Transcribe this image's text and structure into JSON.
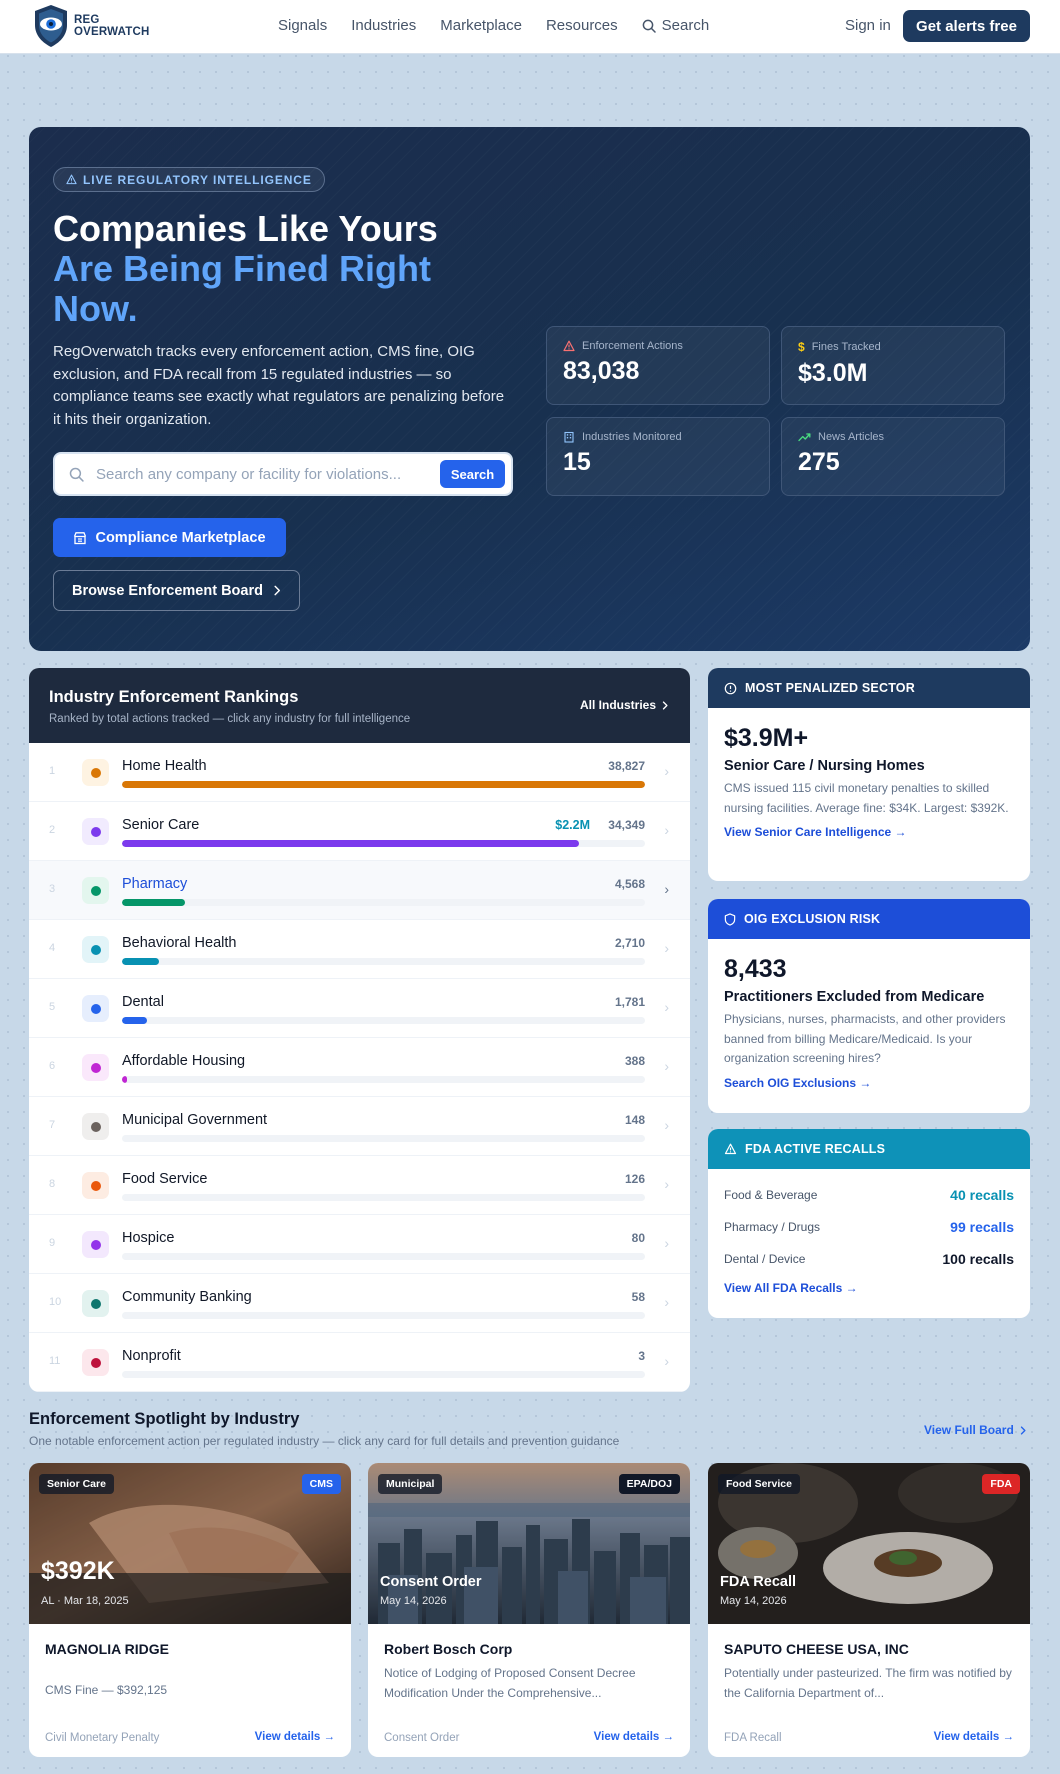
{
  "brand": {
    "line1": "REG",
    "line2": "OVERWATCH"
  },
  "nav": {
    "links": [
      "Signals",
      "Industries",
      "Marketplace",
      "Resources"
    ],
    "search_label": "Search",
    "signin": "Sign in",
    "cta": "Get alerts free"
  },
  "hero": {
    "pill": "LIVE REGULATORY INTELLIGENCE",
    "title_line1": "Companies Like Yours",
    "title_accent": "Are Being Fined Right Now.",
    "description": "RegOverwatch tracks every enforcement action, CMS fine, OIG exclusion, and FDA recall from 15 regulated industries — so compliance teams see exactly what regulators are penalizing before it hits their organization.",
    "search_placeholder": "Search any company or facility for violations...",
    "search_button": "Search",
    "btn_marketplace": "Compliance Marketplace",
    "btn_browse": "Browse Enforcement Board",
    "stats": [
      {
        "label": "Enforcement Actions",
        "value": "83,038"
      },
      {
        "label": "Fines Tracked",
        "value": "$3.0M"
      },
      {
        "label": "Industries Monitored",
        "value": "15"
      },
      {
        "label": "News Articles",
        "value": "275"
      }
    ]
  },
  "rankings": {
    "title": "Industry Enforcement Rankings",
    "subtitle": "Ranked by total actions tracked — click any industry for full intelligence",
    "all_label": "All Industries",
    "rows": [
      {
        "rank": "1",
        "name": "Home Health",
        "count": "38,827",
        "fine": "",
        "level": 1.0,
        "color": "#d97706",
        "bg": "#fef3e2"
      },
      {
        "rank": "2",
        "name": "Senior Care",
        "count": "34,349",
        "fine": "$2.2M",
        "level": 0.874,
        "color": "#7c3aed",
        "bg": "#f1ebfe"
      },
      {
        "rank": "3",
        "name": "Pharmacy",
        "count": "4,568",
        "fine": "",
        "level": 0.12,
        "color": "#059669",
        "bg": "#e3f6ee"
      },
      {
        "rank": "4",
        "name": "Behavioral Health",
        "count": "2,710",
        "fine": "",
        "level": 0.071,
        "color": "#0891b2",
        "bg": "#e2f4f8"
      },
      {
        "rank": "5",
        "name": "Dental",
        "count": "1,781",
        "fine": "",
        "level": 0.047,
        "color": "#2563eb",
        "bg": "#e6eefd"
      },
      {
        "rank": "6",
        "name": "Affordable Housing",
        "count": "388",
        "fine": "",
        "level": 0.008,
        "color": "#c026d3",
        "bg": "#fae8fb"
      },
      {
        "rank": "7",
        "name": "Municipal Government",
        "count": "148",
        "fine": "",
        "level": 0.0,
        "color": "#6b625e",
        "bg": "#efeeed"
      },
      {
        "rank": "8",
        "name": "Food Service",
        "count": "126",
        "fine": "",
        "level": 0.0,
        "color": "#ea580c",
        "bg": "#fdece2"
      },
      {
        "rank": "9",
        "name": "Hospice",
        "count": "80",
        "fine": "",
        "level": 0.0,
        "color": "#9333ea",
        "bg": "#f3e8fd"
      },
      {
        "rank": "10",
        "name": "Community Banking",
        "count": "58",
        "fine": "",
        "level": 0.0,
        "color": "#0f766e",
        "bg": "#e2f2ef"
      },
      {
        "rank": "11",
        "name": "Nonprofit",
        "count": "3",
        "fine": "",
        "level": 0.0,
        "color": "#be123c",
        "bg": "#fce7ec"
      }
    ]
  },
  "penalized": {
    "header": "MOST PENALIZED SECTOR",
    "value": "$3.9M+",
    "sector": "Senior Care / Nursing Homes",
    "description": "CMS issued 115 civil monetary penalties to skilled nursing facilities. Average fine: $34K. Largest: $392K.",
    "link": "View Senior Care Intelligence →"
  },
  "oig": {
    "header": "OIG EXCLUSION RISK",
    "value": "8,433",
    "subtitle": "Practitioners Excluded from Medicare",
    "description": "Physicians, nurses, pharmacists, and other providers banned from billing Medicare/Medicaid. Is your organization screening hires?",
    "link": "Search OIG Exclusions →"
  },
  "fda": {
    "header": "FDA ACTIVE RECALLS",
    "rows": [
      {
        "label": "Food & Beverage",
        "value": "40 recalls",
        "color": "#0891b2"
      },
      {
        "label": "Pharmacy / Drugs",
        "value": "99 recalls",
        "color": "#2563eb"
      },
      {
        "label": "Dental / Device",
        "value": "100 recalls",
        "color": "#0f172a"
      }
    ],
    "link": "View All FDA Recalls →"
  },
  "spotlight": {
    "title": "Enforcement Spotlight by Industry",
    "subtitle": "One notable enforcement action per regulated industry — click any card for full details and prevention guidance",
    "full_board": "View Full Board",
    "cards": [
      {
        "tag": "Senior Care",
        "agency": "CMS",
        "agency_color": "#2563eb",
        "headline": "$392K",
        "meta": "AL · Mar 18, 2025",
        "company": "MAGNOLIA RIDGE",
        "description": "CMS Fine — $392,125",
        "type": "Civil Monetary Penalty",
        "link": "View details →"
      },
      {
        "tag": "Municipal",
        "agency": "EPA/DOJ",
        "agency_color": "#111827",
        "headline": "Consent Order",
        "meta": "May 14, 2026",
        "company": "Robert Bosch Corp",
        "description": "Notice of Lodging of Proposed Consent Decree Modification Under the Comprehensive...",
        "type": "Consent Order",
        "link": "View details →"
      },
      {
        "tag": "Food Service",
        "agency": "FDA",
        "agency_color": "#dc2626",
        "headline": "FDA Recall",
        "meta": "May 14, 2026",
        "company": "SAPUTO CHEESE USA, INC",
        "description": "Potentially under pasteurized. The firm was notified by the California Department of...",
        "type": "FDA Recall",
        "link": "View details →"
      }
    ]
  }
}
